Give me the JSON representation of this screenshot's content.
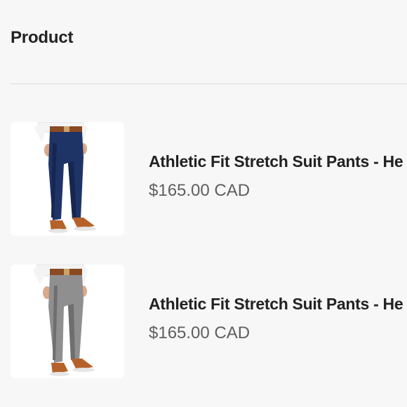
{
  "header": {
    "title": "Product"
  },
  "products": [
    {
      "title": "Athletic Fit Stretch Suit Pants - He",
      "price": "$165.00 CAD",
      "pants_color": "#1f3466",
      "pants_shade": "#162650",
      "image_icon": "navy-pants-image"
    },
    {
      "title": "Athletic Fit Stretch Suit Pants - He",
      "price": "$165.00 CAD",
      "pants_color": "#8f8f8f",
      "pants_shade": "#6e6e6e",
      "image_icon": "gray-pants-image"
    }
  ],
  "colors": {
    "background": "#f7f7f7",
    "divider": "#dcdcdc",
    "shoe": "#b5622a",
    "belt": "#8a4a22",
    "shirt": "#f4f4f4",
    "skin": "#d9a989"
  }
}
